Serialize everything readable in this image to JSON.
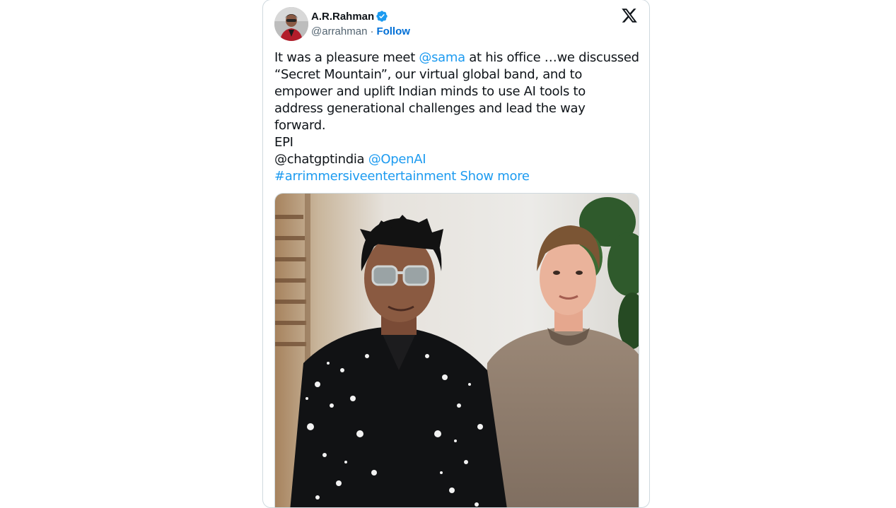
{
  "author": {
    "display_name": "A.R.Rahman",
    "handle": "@arrahman",
    "separator": "·",
    "follow_label": "Follow",
    "verified": true
  },
  "tweet": {
    "line1_pre": "It was a pleasure meet ",
    "line1_mention": "@sama",
    "line1_post": " at his office …we discussed",
    "line2": "“Secret Mountain”, our virtual global band, and to",
    "line3": "empower and uplift Indian minds to use AI tools to",
    "line4": "address generational challenges and lead the way",
    "line5": "forward.",
    "line6": "EPI",
    "line7_pre": "@chatgptindia ",
    "line7_mention": "@OpenAI",
    "line8_hashtag": "#arrimmersiveentertainment",
    "show_more": "Show more"
  },
  "icons": {
    "verified": "verified-badge-icon",
    "platform": "x-logo-icon"
  },
  "colors": {
    "link": "#1d9bf0",
    "follow": "#006fd6",
    "verified": "#1d9bf0",
    "text": "#0f1419",
    "secondary": "#536471"
  }
}
